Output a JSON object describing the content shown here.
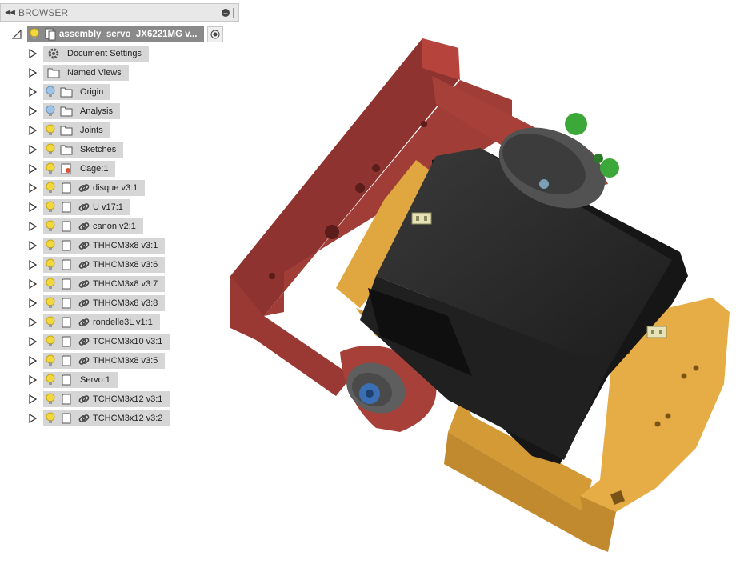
{
  "browser": {
    "title": "BROWSER",
    "root": {
      "label": "assembly_servo_JX6221MG v..."
    },
    "items": [
      {
        "label": "Document Settings",
        "bulb": "",
        "type": "settings",
        "link": false
      },
      {
        "label": "Named Views",
        "bulb": "",
        "type": "folder",
        "link": false
      },
      {
        "label": "Origin",
        "bulb": "off",
        "type": "folder",
        "link": false
      },
      {
        "label": "Analysis",
        "bulb": "off",
        "type": "folder",
        "link": false
      },
      {
        "label": "Joints",
        "bulb": "on",
        "type": "folder",
        "link": false
      },
      {
        "label": "Sketches",
        "bulb": "on",
        "type": "folder",
        "link": false
      },
      {
        "label": "Cage:1",
        "bulb": "on",
        "type": "component-active",
        "link": false
      },
      {
        "label": "disque v3:1",
        "bulb": "on",
        "type": "component",
        "link": true
      },
      {
        "label": "U v17:1",
        "bulb": "on",
        "type": "component",
        "link": true
      },
      {
        "label": "canon v2:1",
        "bulb": "on",
        "type": "component",
        "link": true
      },
      {
        "label": "THHCM3x8 v3:1",
        "bulb": "on",
        "type": "component",
        "link": true
      },
      {
        "label": "THHCM3x8 v3:6",
        "bulb": "on",
        "type": "component",
        "link": true
      },
      {
        "label": "THHCM3x8 v3:7",
        "bulb": "on",
        "type": "component",
        "link": true
      },
      {
        "label": "THHCM3x8 v3:8",
        "bulb": "on",
        "type": "component",
        "link": true
      },
      {
        "label": "rondelle3L v1:1",
        "bulb": "on",
        "type": "component",
        "link": true
      },
      {
        "label": "TCHCM3x10 v3:1",
        "bulb": "on",
        "type": "component",
        "link": true
      },
      {
        "label": "THHCM3x8 v3:5",
        "bulb": "on",
        "type": "component",
        "link": true
      },
      {
        "label": "Servo:1",
        "bulb": "on",
        "type": "component",
        "link": false
      },
      {
        "label": "TCHCM3x12 v3:1",
        "bulb": "on",
        "type": "component",
        "link": true
      },
      {
        "label": "TCHCM3x12 v3:2",
        "bulb": "on",
        "type": "component",
        "link": true
      }
    ]
  },
  "colors": {
    "frame_red": "#a8403a",
    "bracket_orange": "#d9a03a",
    "servo_black": "#262626",
    "accent_green": "#3da83a",
    "screw_blue": "#3b6fb5",
    "bulb_on": "#f2d83b",
    "bulb_off": "#9ec4ea"
  }
}
